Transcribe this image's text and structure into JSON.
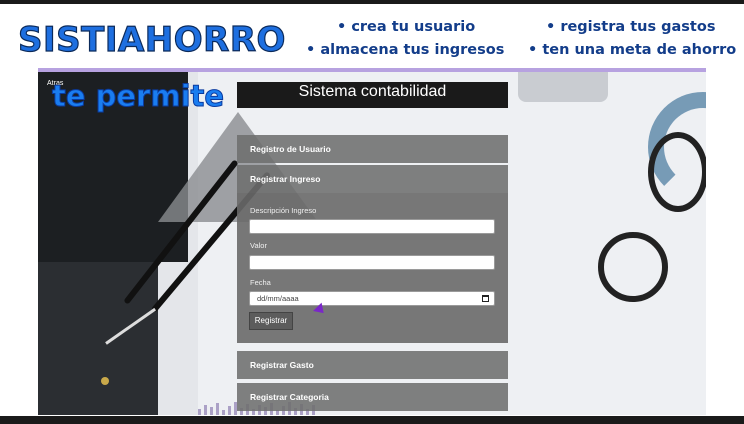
{
  "header": {
    "brand": "SISTIAHORRO",
    "bullets": [
      "• crea tu usuario",
      "• almacena tus  ingresos",
      "• registra tus gastos",
      "• ten una meta de ahorro"
    ],
    "colors": {
      "brand": "#1e6fe0",
      "bullets": "#133d8a",
      "divider": "#b7a2e0"
    }
  },
  "slide": {
    "back_link": "Atras",
    "tagline": "te permite"
  },
  "app": {
    "title": "Sistema contabilidad",
    "sections": {
      "usuario": "Registro de Usuario",
      "ingreso": "Registrar Ingreso",
      "gasto": "Registrar Gasto",
      "categoria": "Registrar Categoria"
    },
    "form": {
      "descripcion_label": "Descripción Ingreso",
      "descripcion_value": "",
      "valor_label": "Valor",
      "valor_value": "",
      "fecha_label": "Fecha",
      "fecha_placeholder": "dd/mm/aaaa",
      "submit_label": "Registrar"
    }
  },
  "icons": [
    "calendar-icon",
    "mouse-cursor-icon"
  ]
}
